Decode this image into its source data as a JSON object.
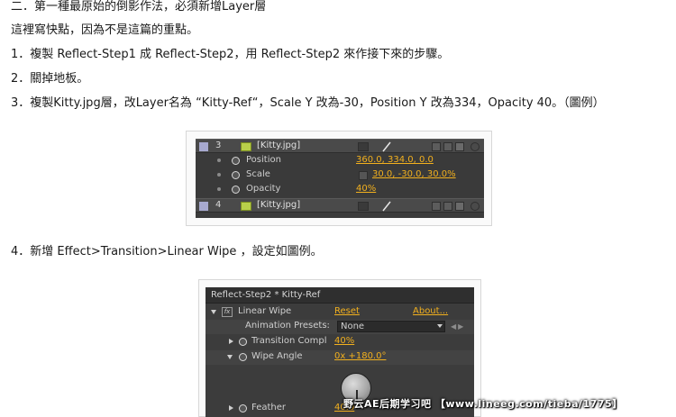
{
  "text": {
    "heading": "二．第一種最原始的倒影作法，必須新增Layer層",
    "intro": "這裡寫快點，因為不是這篇的重點。",
    "step1": "1．複製 Reflect-Step1 成 Reflect-Step2，用 Reflect-Step2 來作接下來的步驟。",
    "step2": "2．關掉地板。",
    "step3": "3．複製Kitty.jpg層，改Layer名為 “Kitty-Ref“，Scale Y 改為-30，Position Y 改為334，Opacity 40。（圖例）",
    "step4": "4．新增 Effect>Transition>Linear Wipe ，設定如圖例。"
  },
  "timeline": {
    "layers": [
      {
        "num": "3",
        "name": "[Kitty.jpg]"
      },
      {
        "num": "4",
        "name": "[Kitty.jpg]"
      }
    ],
    "props": [
      {
        "name": "Position",
        "value": "360.0, 334.0, 0.0"
      },
      {
        "name": "Scale",
        "value": "30.0, -30.0, 30.0%"
      },
      {
        "name": "Opacity",
        "value": "40%"
      }
    ],
    "colors": {
      "label": "#a7a9cf",
      "value": "#f2b01e",
      "panel": "#3b3b3b"
    }
  },
  "effect_panel": {
    "title": "Reflect-Step2 * Kitty-Ref",
    "effect_name": "Linear Wipe",
    "reset": "Reset",
    "about": "About...",
    "presets_label": "Animation Presets:",
    "presets_value": "None",
    "transition_label": "Transition Compl",
    "transition_value": "40%",
    "wipe_angle_label": "Wipe Angle",
    "wipe_angle_value": "0x +180.0°",
    "feather_label": "Feather",
    "feather_value": "40.0"
  },
  "watermark": "野云AE后期学习吧 【www.lineeg.com/tieba/1775】"
}
